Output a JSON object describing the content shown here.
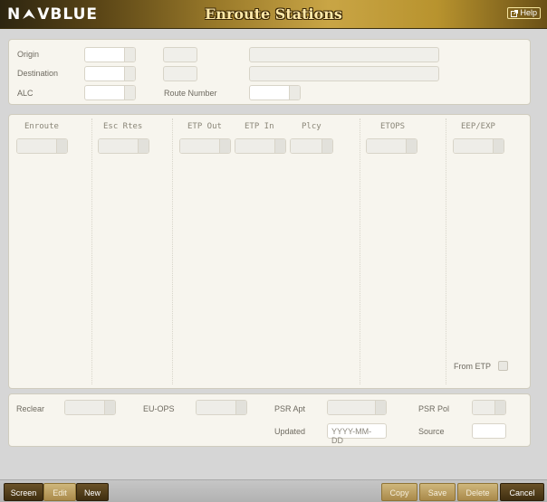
{
  "header": {
    "logo": "NAVBLUE",
    "title": "Enroute Stations",
    "help_label": "Help"
  },
  "top": {
    "origin_label": "Origin",
    "destination_label": "Destination",
    "alc_label": "ALC",
    "route_number_label": "Route Number"
  },
  "grid": {
    "columns": [
      "Enroute",
      "Esc Rtes",
      "ETP Out",
      "ETP In",
      "Plcy",
      "ETOPS",
      "EEP/EXP"
    ],
    "from_etp_label": "From ETP"
  },
  "bottom": {
    "reclear_label": "Reclear",
    "euops_label": "EU-OPS",
    "psr_apt_label": "PSR Apt",
    "psr_pol_label": "PSR Pol",
    "updated_label": "Updated",
    "updated_placeholder": "YYYY-MM-DD",
    "source_label": "Source"
  },
  "footer": {
    "screen": "Screen",
    "edit": "Edit",
    "new": "New",
    "copy": "Copy",
    "save": "Save",
    "delete": "Delete",
    "cancel": "Cancel"
  },
  "colors": {
    "brand_gold": "#c9a545",
    "panel_bg": "#f7f5ee",
    "dark_button": "#3f2e10"
  }
}
